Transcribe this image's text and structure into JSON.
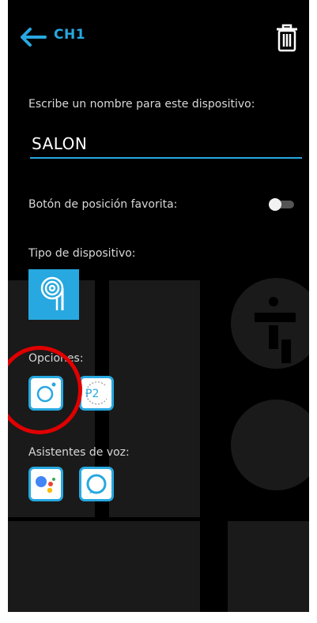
{
  "header": {
    "title": "CH1",
    "back_icon": "arrow-left-icon",
    "delete_icon": "trash-icon"
  },
  "name_section": {
    "label": "Escribe un nombre para este dispositivo:",
    "value": "SALON"
  },
  "favorite": {
    "label": "Botón de posición favorita:",
    "toggle_on": false
  },
  "device_type": {
    "label": "Tipo de dispositivo:",
    "icon": "blind-roll-icon"
  },
  "options": {
    "label": "Opciones:",
    "items": [
      {
        "icon": "circle-dot-icon"
      },
      {
        "icon": "p2-position-icon",
        "text": "P2"
      }
    ]
  },
  "voice": {
    "label": "Asistentes de voz:",
    "items": [
      {
        "icon": "google-assistant-icon"
      },
      {
        "icon": "alexa-icon"
      }
    ]
  },
  "colors": {
    "accent": "#27a8e0",
    "background": "#000000",
    "highlight": "#e00000"
  }
}
